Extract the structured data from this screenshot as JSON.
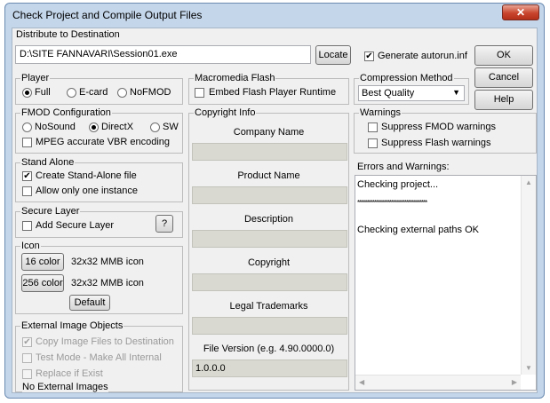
{
  "window": {
    "title": "Check Project and Compile Output Files",
    "close_glyph": "✕"
  },
  "distribute": {
    "label": "Distribute to Destination",
    "path": "D:\\SITE FANNAVARI\\Session01.exe",
    "locate_label": "Locate",
    "autorun_label": "Generate autorun.inf",
    "autorun_checked": true
  },
  "buttons": {
    "ok": "OK",
    "cancel": "Cancel",
    "help": "Help"
  },
  "player": {
    "title": "Player",
    "options": [
      "Full",
      "E-card",
      "NoFMOD"
    ],
    "selected": "Full"
  },
  "flash": {
    "title": "Macromedia Flash",
    "embed_label": "Embed Flash Player Runtime",
    "embed_checked": false
  },
  "compression": {
    "title": "Compression Method",
    "selected": "Best Quality",
    "arrow_glyph": "▼"
  },
  "fmod": {
    "title": "FMOD Configuration",
    "options": [
      "NoSound",
      "DirectX",
      "SW"
    ],
    "selected": "DirectX",
    "mpeg_label": "MPEG accurate VBR encoding",
    "mpeg_checked": false
  },
  "standalone": {
    "title": "Stand Alone",
    "create_label": "Create Stand-Alone file",
    "create_checked": true,
    "one_instance_label": "Allow only one instance",
    "one_instance_checked": false
  },
  "secure": {
    "title": "Secure Layer",
    "add_label": "Add Secure Layer",
    "add_checked": false,
    "help_label": "?"
  },
  "icon": {
    "title": "Icon",
    "btn16": "16 color",
    "desc16": "32x32 MMB icon",
    "btn256": "256 color",
    "desc256": "32x32 MMB icon",
    "default_label": "Default"
  },
  "external": {
    "title": "External Image Objects",
    "copy_label": "Copy Image Files to Destination",
    "copy_checked": true,
    "test_label": "Test Mode - Make All Internal",
    "replace_label": "Replace if Exist",
    "status": "No External Images"
  },
  "copyright": {
    "title": "Copyright Info",
    "company_label": "Company Name",
    "company_value": "",
    "product_label": "Product Name",
    "product_value": "",
    "description_label": "Description",
    "description_value": "",
    "copyright_label": "Copyright",
    "copyright_value": "",
    "trademarks_label": "Legal Trademarks",
    "trademarks_value": "",
    "version_label": "File Version (e.g. 4.90.0000.0)",
    "version_value": "1.0.0.0"
  },
  "warnings": {
    "title": "Warnings",
    "fmod_label": "Suppress FMOD warnings",
    "flash_label": "Suppress Flash warnings"
  },
  "errors": {
    "label": "Errors and Warnings:",
    "lines": [
      "Checking project...",
      "*************************************",
      "",
      "Checking external paths OK"
    ],
    "scroll_up": "▲",
    "scroll_down": "▼",
    "scroll_left": "◀",
    "scroll_right": "▶"
  }
}
